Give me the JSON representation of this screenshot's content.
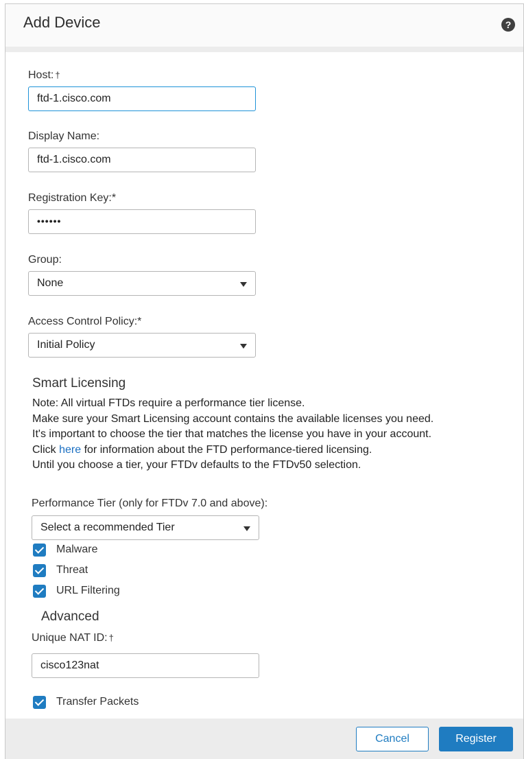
{
  "dialog": {
    "title": "Add Device",
    "help_icon": "help-icon",
    "help_glyph": "?"
  },
  "form": {
    "host": {
      "label": "Host:",
      "marker": "†",
      "value": "ftd-1.cisco.com"
    },
    "display_name": {
      "label": "Display Name:",
      "value": "ftd-1.cisco.com"
    },
    "registration_key": {
      "label": "Registration Key:*",
      "value": "••••••"
    },
    "group": {
      "label": "Group:",
      "selected": "None"
    },
    "access_control_policy": {
      "label": "Access Control Policy:*",
      "selected": "Initial Policy"
    }
  },
  "smart_licensing": {
    "title": "Smart Licensing",
    "line1": "Note: All virtual FTDs require a performance tier license.",
    "line2": "Make sure your Smart Licensing account contains the available licenses you need.",
    "line3": "It's important to choose the tier that matches the license you have in your account.",
    "line4_prefix": "Click ",
    "line4_link": "here",
    "line4_suffix": " for information about the FTD performance-tiered licensing.",
    "line5": "Until you choose a tier, your FTDv defaults to the FTDv50 selection.",
    "performance_tier_label": "Performance Tier (only for FTDv 7.0 and above):",
    "performance_tier_selected": "Select a recommended Tier",
    "checkboxes": [
      {
        "label": "Malware",
        "checked": true
      },
      {
        "label": "Threat",
        "checked": true
      },
      {
        "label": "URL Filtering",
        "checked": true
      }
    ]
  },
  "advanced": {
    "title": "Advanced",
    "nat_label": "Unique NAT ID:",
    "nat_marker": "†",
    "nat_value": "cisco123nat",
    "transfer_packets": {
      "label": "Transfer Packets",
      "checked": true
    }
  },
  "footer": {
    "cancel_label": "Cancel",
    "register_label": "Register"
  },
  "colors": {
    "accent": "#1f7cc1",
    "focus_border": "#1e92d8",
    "link": "#1a6fc2"
  }
}
